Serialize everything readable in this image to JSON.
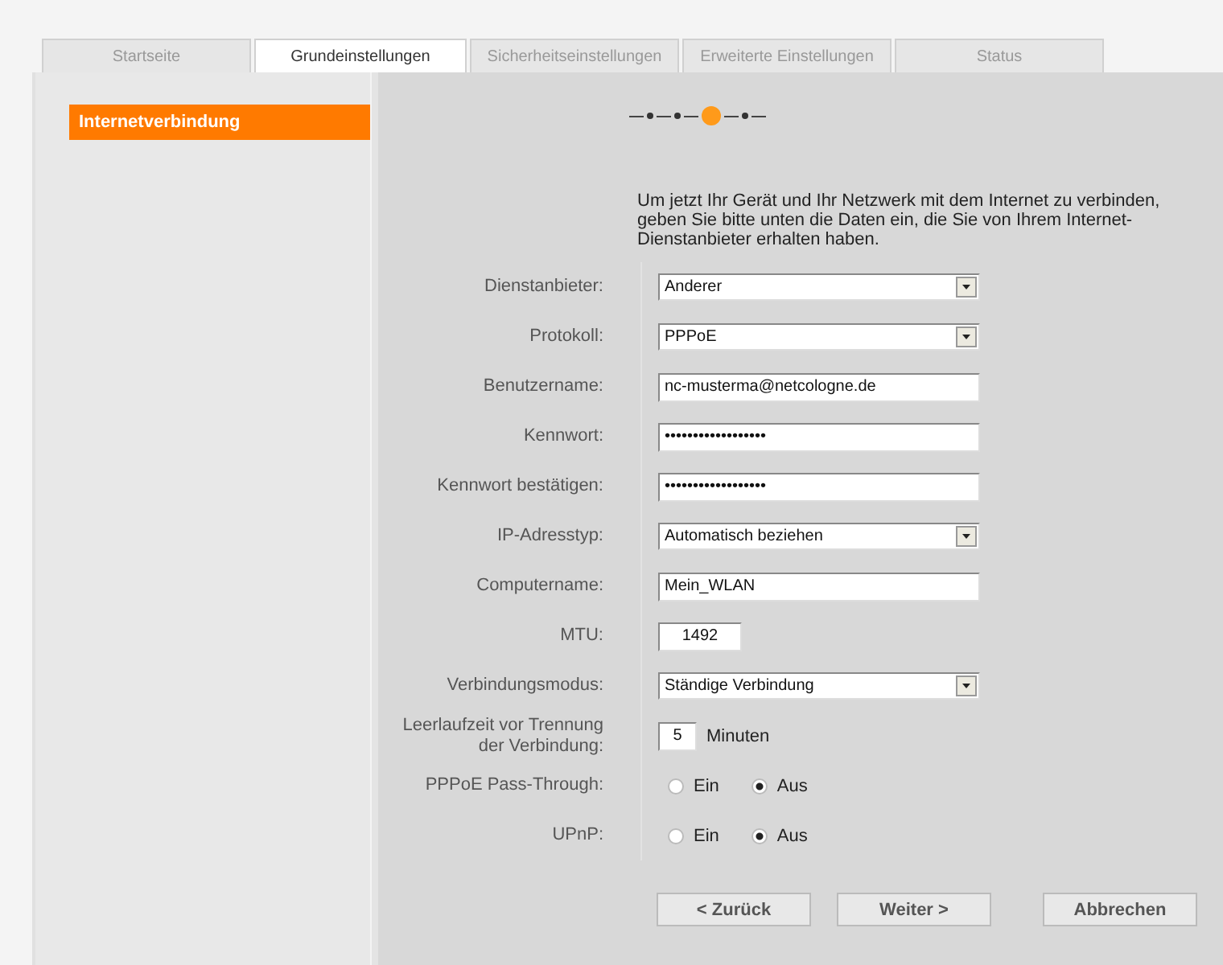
{
  "tabs": [
    {
      "label": "Startseite",
      "selected": false
    },
    {
      "label": "Grundeinstellungen",
      "selected": true
    },
    {
      "label": "Sicherheitseinstellungen",
      "selected": false
    },
    {
      "label": "Erweiterte Einstellungen",
      "selected": false
    },
    {
      "label": "Status",
      "selected": false
    }
  ],
  "sidebar": {
    "items": [
      {
        "label": "Internetverbindung",
        "selected": true
      }
    ]
  },
  "steps": [
    {
      "selected": false
    },
    {
      "selected": false
    },
    {
      "selected": true
    },
    {
      "selected": false
    }
  ],
  "intro": "Um jetzt Ihr Gerät und Ihr Netzwerk mit dem Internet zu verbinden, geben Sie bitte unten die Daten ein, die Sie von Ihrem Internet-Dienstanbieter erhalten haben.",
  "fields": [
    {
      "kind": "select",
      "label": "Dienstanbieter:",
      "value": "Anderer"
    },
    {
      "kind": "select",
      "label": "Protokoll:",
      "value": "PPPoE"
    },
    {
      "kind": "text",
      "label": "Benutzername:",
      "value": "nc-musterma@netcologne.de"
    },
    {
      "kind": "text",
      "label": "Kennwort:",
      "value": "••••••••••••••••••"
    },
    {
      "kind": "text",
      "label": "Kennwort bestätigen:",
      "value": "••••••••••••••••••"
    },
    {
      "kind": "select",
      "label": "IP-Adresstyp:",
      "value": "Automatisch beziehen"
    },
    {
      "kind": "text",
      "label": "Computername:",
      "value": "Mein_WLAN"
    },
    {
      "kind": "short",
      "label": "MTU:",
      "value": "1492"
    },
    {
      "kind": "select",
      "label": "Verbindungsmodus:",
      "value": "Ständige Verbindung"
    },
    {
      "kind": "unit",
      "label": "Leerlaufzeit vor Trennung der Verbindung:",
      "value": "5",
      "unit": "Minuten"
    },
    {
      "kind": "radio",
      "label": "PPPoE Pass-Through:",
      "options": [
        {
          "label": "Ein",
          "selected": false
        },
        {
          "label": "Aus",
          "selected": true
        }
      ]
    },
    {
      "kind": "radio",
      "label": "UPnP:",
      "options": [
        {
          "label": "Ein",
          "selected": false
        },
        {
          "label": "Aus",
          "selected": true
        }
      ]
    }
  ],
  "buttons": [
    "< Zurück",
    "Weiter >",
    "Abbrechen"
  ]
}
